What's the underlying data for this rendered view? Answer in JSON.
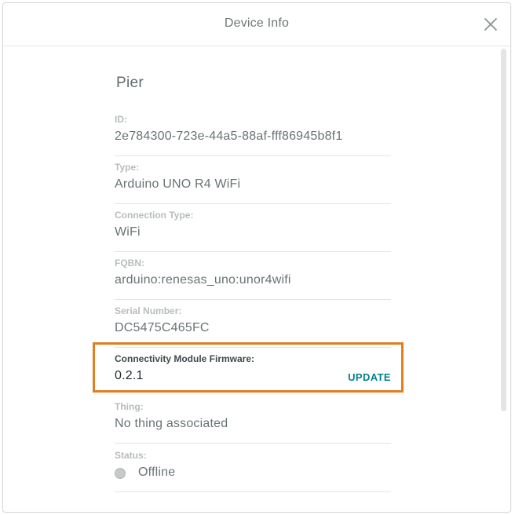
{
  "dialog": {
    "title": "Device Info",
    "close_icon": "close-icon"
  },
  "device": {
    "name": "Pier",
    "fields": {
      "id": {
        "label": "ID:",
        "value": "2e784300-723e-44a5-88af-fff86945b8f1"
      },
      "type": {
        "label": "Type:",
        "value": "Arduino UNO R4 WiFi"
      },
      "connection_type": {
        "label": "Connection Type:",
        "value": "WiFi"
      },
      "fqbn": {
        "label": "FQBN:",
        "value": "arduino:renesas_uno:unor4wifi"
      },
      "serial_number": {
        "label": "Serial Number:",
        "value": "DC5475C465FC"
      },
      "firmware": {
        "label": "Connectivity Module Firmware:",
        "value": "0.2.1",
        "action_label": "UPDATE"
      },
      "thing": {
        "label": "Thing:",
        "value": "No thing associated"
      },
      "status": {
        "label": "Status:",
        "value": "Offline",
        "indicator_color": "#c6c9ca"
      }
    }
  },
  "colors": {
    "accent": "#00838a",
    "highlight": "#e07f21"
  }
}
